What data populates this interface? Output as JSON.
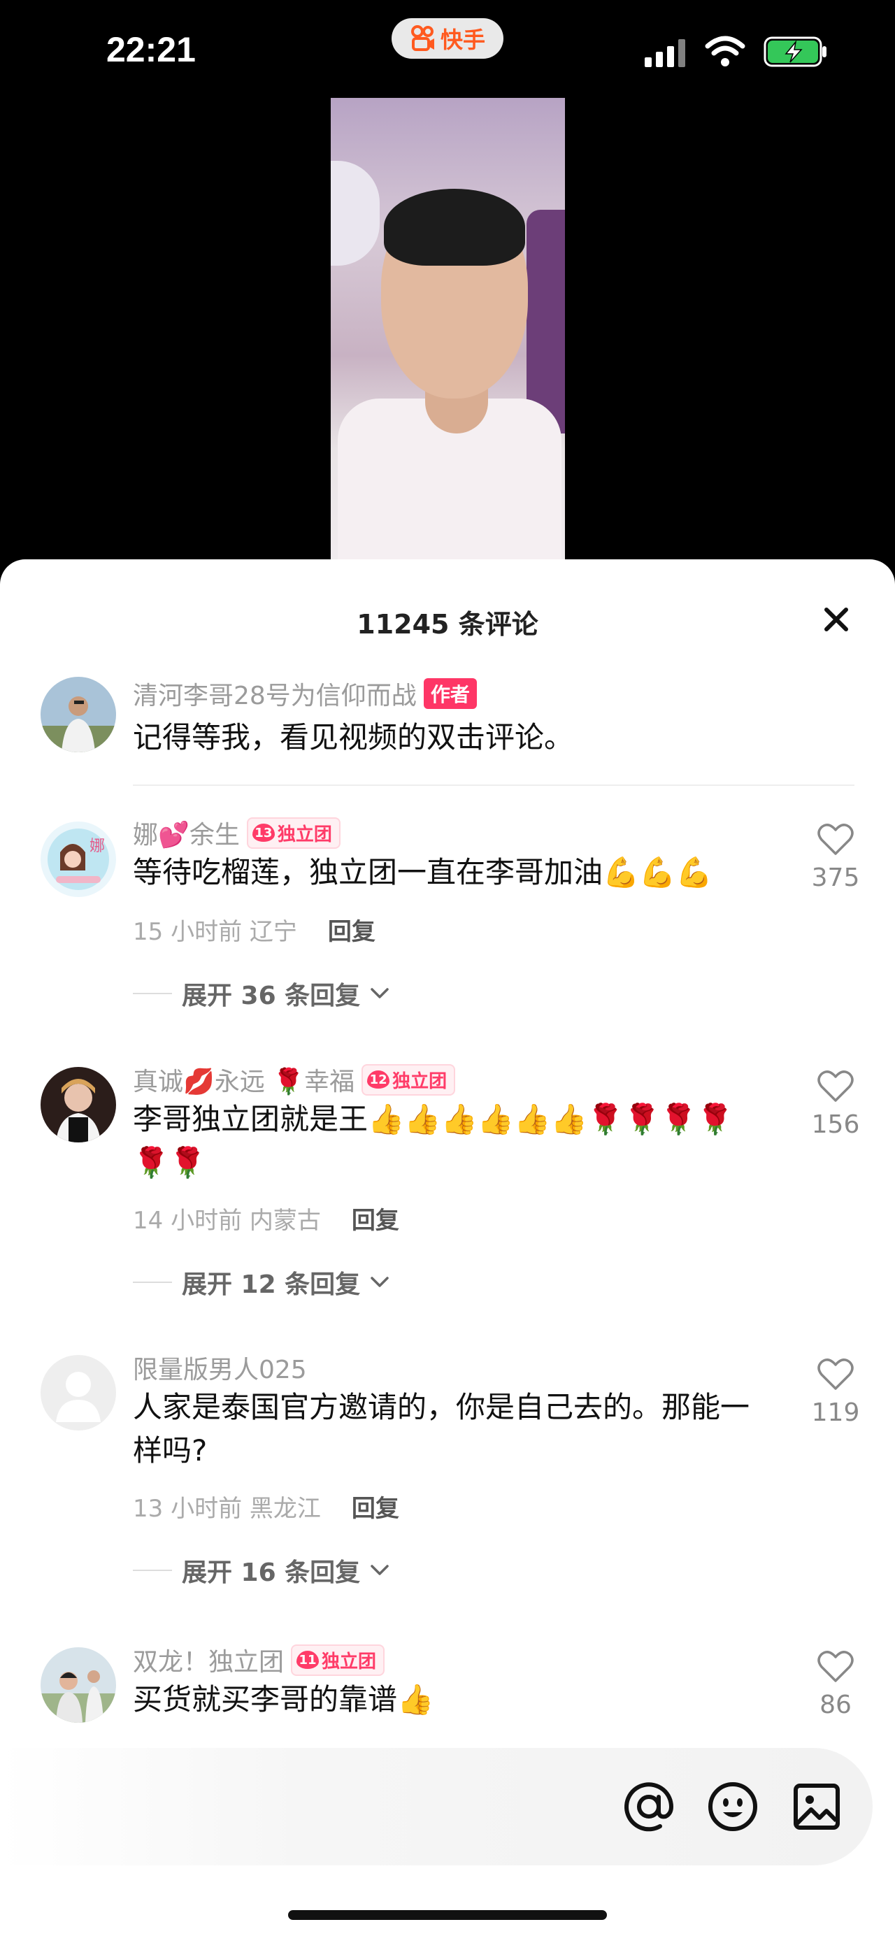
{
  "status_bar": {
    "time": "22:21",
    "app_name": "快手",
    "brand_color": "#ff5a1f",
    "battery_color": "#34c759"
  },
  "video": {
    "description_icon": "video-thumbnail"
  },
  "comments_header": {
    "title": "11245 条评论"
  },
  "comments": [
    {
      "username": "清河李哥28号为信仰而战",
      "badge": "作者",
      "text": "记得等我，看见视频的双击评论。"
    },
    {
      "username": "娜💕余生",
      "fan_badge_level": "13",
      "fan_badge_label": "独立团",
      "text": "等待吃榴莲，独立团一直在李哥加油💪💪💪",
      "time": "15 小时前",
      "location": "辽宁",
      "reply_label": "回复",
      "likes": "375",
      "expand_label": "展开 36 条回复"
    },
    {
      "username": "真诚💋永远 🌹幸福",
      "fan_badge_level": "12",
      "fan_badge_label": "独立团",
      "text": "李哥独立团就是王👍👍👍👍👍👍🌹🌹🌹🌹🌹🌹",
      "time": "14 小时前",
      "location": "内蒙古",
      "reply_label": "回复",
      "likes": "156",
      "expand_label": "展开 12 条回复"
    },
    {
      "username": "限量版男人025",
      "text": "人家是泰国官方邀请的，你是自己去的。那能一样吗?",
      "time": "13 小时前",
      "location": "黑龙江",
      "reply_label": "回复",
      "likes": "119",
      "expand_label": "展开 16 条回复"
    },
    {
      "username": "双龙！独立团",
      "fan_badge_level": "11",
      "fan_badge_label": "独立团",
      "text": "买货就买李哥的靠谱👍",
      "likes": "86"
    }
  ],
  "input_bar": {
    "icons": [
      "at-icon",
      "emoji-icon",
      "image-icon"
    ]
  }
}
